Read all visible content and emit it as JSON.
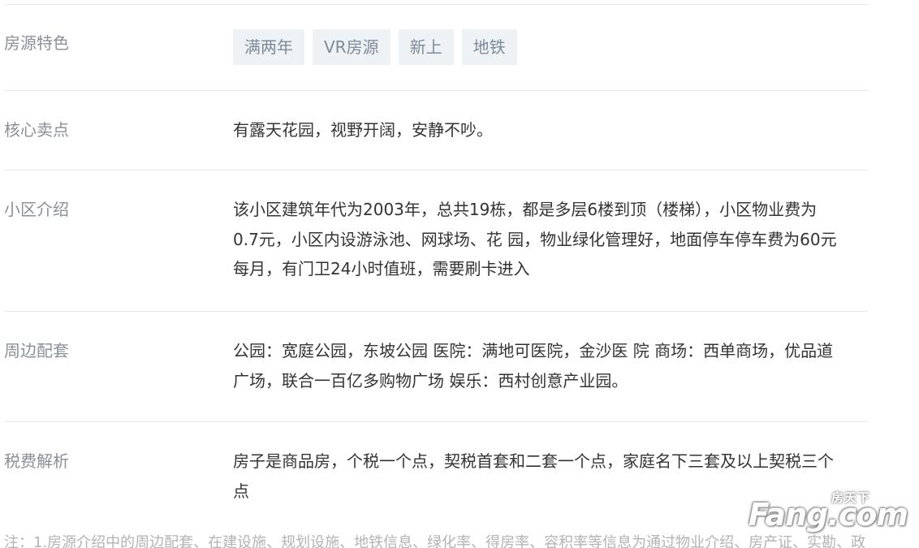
{
  "rows": [
    {
      "label": "房源特色",
      "tags": [
        "满两年",
        "VR房源",
        "新上",
        "地铁"
      ]
    },
    {
      "label": "核心卖点",
      "lines": [
        "有露天花园，视野开阔，安静不吵。"
      ]
    },
    {
      "label": "小区介绍",
      "lines": [
        "该小区建筑年代为2003年，总共19栋，都是多层6楼到顶（楼梯），小区物业费为",
        "0.7元，小区内设游泳池、网球场、花 园，物业绿化管理好，地面停车停车费为60元",
        "每月，有门卫24小时值班，需要刷卡进入"
      ]
    },
    {
      "label": "周边配套",
      "lines": [
        "公园：宽庭公园，东坡公园 医院：满地可医院，金沙医 院 商场：西单商场，优品道",
        "广场，联合一百亿多购物广场 娱乐：西村创意产业园。"
      ]
    },
    {
      "label": "税费解析",
      "lines": [
        "房子是商品房，个税一个点，契税首套和二套一个点，家庭名下三套及以上契税三个",
        "点"
      ]
    }
  ],
  "note": "注：1.房源介绍中的周边配套、在建设施、规划设施、地铁信息、绿化率、得房率、容积率等信息为通过物业介绍、房产证、实勘、政",
  "watermark": {
    "small": "房天下",
    "main": "Fang.com"
  }
}
